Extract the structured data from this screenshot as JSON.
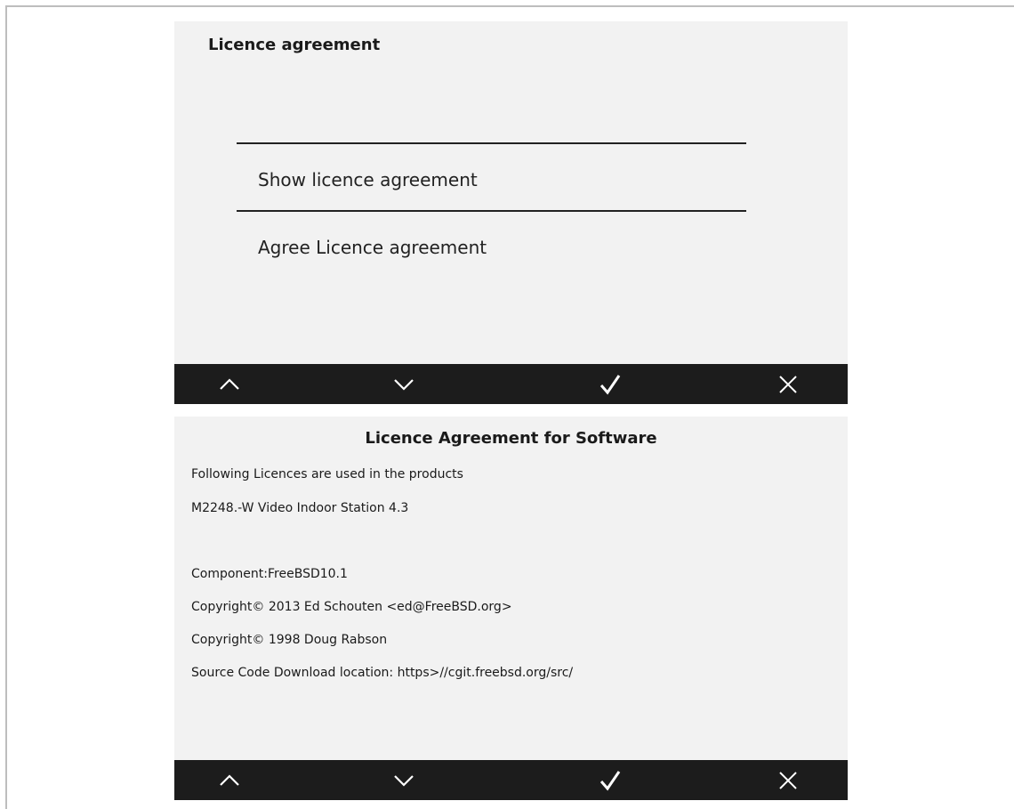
{
  "screen1": {
    "title": "Licence agreement",
    "menu": [
      {
        "label": "Show licence agreement"
      },
      {
        "label": "Agree Licence agreement"
      }
    ]
  },
  "screen2": {
    "title": "Licence Agreement for Software",
    "lines": [
      "Following Licences are used in the products",
      "M2248.-W Video Indoor Station 4.3",
      "Component:FreeBSD10.1",
      "Copyright© 2013 Ed Schouten <ed@FreeBSD.org>",
      "Copyright© 1998 Doug Rabson",
      "Source Code Download location: https>//cgit.freebsd.org/src/"
    ]
  },
  "navbar": {
    "buttons": [
      "chevron-up-icon",
      "chevron-down-icon",
      "checkmark-icon",
      "close-icon"
    ],
    "background": "#1c1c1c",
    "icon_color": "#ffffff"
  }
}
